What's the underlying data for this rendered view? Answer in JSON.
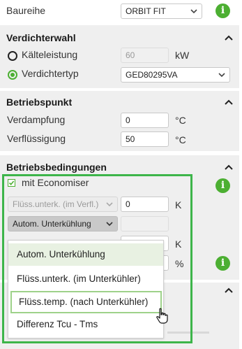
{
  "series": {
    "label": "Baureihe",
    "value": "ORBIT FIT"
  },
  "compressor_selection": {
    "title": "Verdichterwahl",
    "option_capacity": "Kälteleistung",
    "capacity_value": "60",
    "capacity_unit": "kW",
    "option_type": "Verdichtertyp",
    "type_value": "GED80295VA"
  },
  "operating_point": {
    "title": "Betriebspunkt",
    "evaporation_label": "Verdampfung",
    "evaporation_value": "0",
    "evaporation_unit": "°C",
    "condensation_label": "Verflüssigung",
    "condensation_value": "50",
    "condensation_unit": "°C"
  },
  "operating_conditions": {
    "title": "Betriebsbedingungen",
    "economiser_label": "mit Economiser",
    "economiser_checked": true,
    "subcool_select": "Flüss.unterk. (im Verfl.)",
    "subcool_value": "0",
    "subcool_unit": "K",
    "auto_select": "Autom. Unterkühlung",
    "unit_k": "K",
    "unit_percent": "%"
  },
  "dropdown": {
    "options": [
      "Autom. Unterkühlung",
      "Flüss.unterk. (im Unterkühler)",
      "Flüss.temp. (nach Unterkühler)",
      "Differenz Tcu - Tms"
    ],
    "selected_index": 0,
    "hover_index": 2
  },
  "icons": {
    "info": "i",
    "info_color": "#4caf32",
    "accent_color": "#3db54a"
  }
}
